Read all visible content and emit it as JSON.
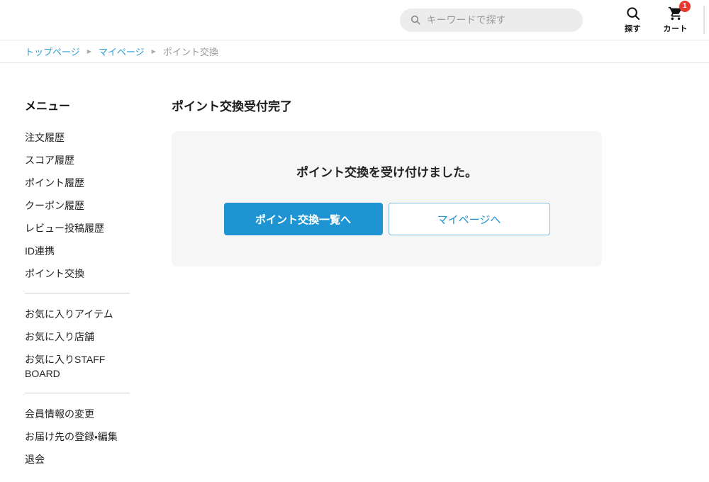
{
  "header": {
    "search": {
      "placeholder": "キーワードで探す"
    },
    "search_button_label": "探す",
    "cart": {
      "label": "カート",
      "badge": "1"
    }
  },
  "breadcrumb": {
    "separator": "▶",
    "items": [
      {
        "label": "トップページ"
      },
      {
        "label": "マイページ"
      },
      {
        "label": "ポイント交換"
      }
    ]
  },
  "sidebar": {
    "title": "メニュー",
    "groups": [
      {
        "items": [
          "注文履歴",
          "スコア履歴",
          "ポイント履歴",
          "クーポン履歴",
          "レビュー投稿履歴",
          "ID連携",
          "ポイント交換"
        ]
      },
      {
        "items": [
          "お気に入りアイテム",
          "お気に入り店舗",
          "お気に入りSTAFF BOARD"
        ]
      },
      {
        "items": [
          "会員情報の変更",
          "お届け先の登録・編集",
          "退会"
        ]
      }
    ]
  },
  "main": {
    "title": "ポイント交換受付完了",
    "message": "ポイント交換を受け付けました。",
    "primary_button": "ポイント交換一覧へ",
    "secondary_button": "マイページへ"
  },
  "icons": {
    "search_pill": "magnifier-icon",
    "search_button": "magnifier-icon",
    "cart_button": "shopping-cart-icon"
  },
  "colors": {
    "accent_blue": "#1e95d2",
    "link_blue": "#2e9fd6",
    "badge_red": "#e8382f",
    "panel_gray": "#f6f6f6"
  }
}
